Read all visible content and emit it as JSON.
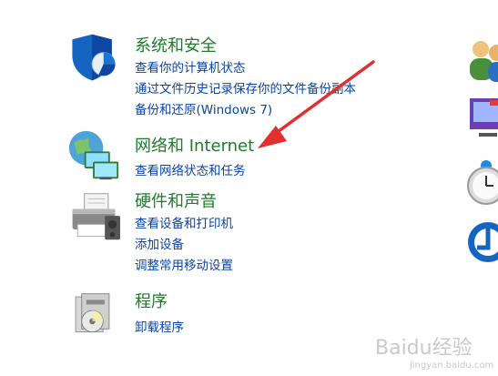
{
  "categories": {
    "system": {
      "title": "系统和安全",
      "links": [
        "查看你的计算机状态",
        "通过文件历史记录保存你的文件备份副本",
        "备份和还原(Windows 7)"
      ]
    },
    "network": {
      "title": "网络和 Internet",
      "links": [
        "查看网络状态和任务"
      ]
    },
    "hardware": {
      "title": "硬件和声音",
      "links": [
        "查看设备和打印机",
        "添加设备",
        "调整常用移动设置"
      ]
    },
    "programs": {
      "title": "程序",
      "links": [
        "卸载程序"
      ]
    }
  },
  "icons": {
    "system": "shield-icon",
    "network": "network-icon",
    "hardware": "printer-icon",
    "programs": "programs-icon",
    "right": [
      "user-accounts-icon",
      "appearance-icon",
      "clock-icon",
      "ease-of-access-icon"
    ]
  },
  "annotation": {
    "arrow_color": "#e03030"
  },
  "watermark": {
    "text": "Baidu经验",
    "sub": "jingyan.baidu.com"
  },
  "colors": {
    "category_title": "#1f7a2a",
    "link": "#0b43a3"
  }
}
